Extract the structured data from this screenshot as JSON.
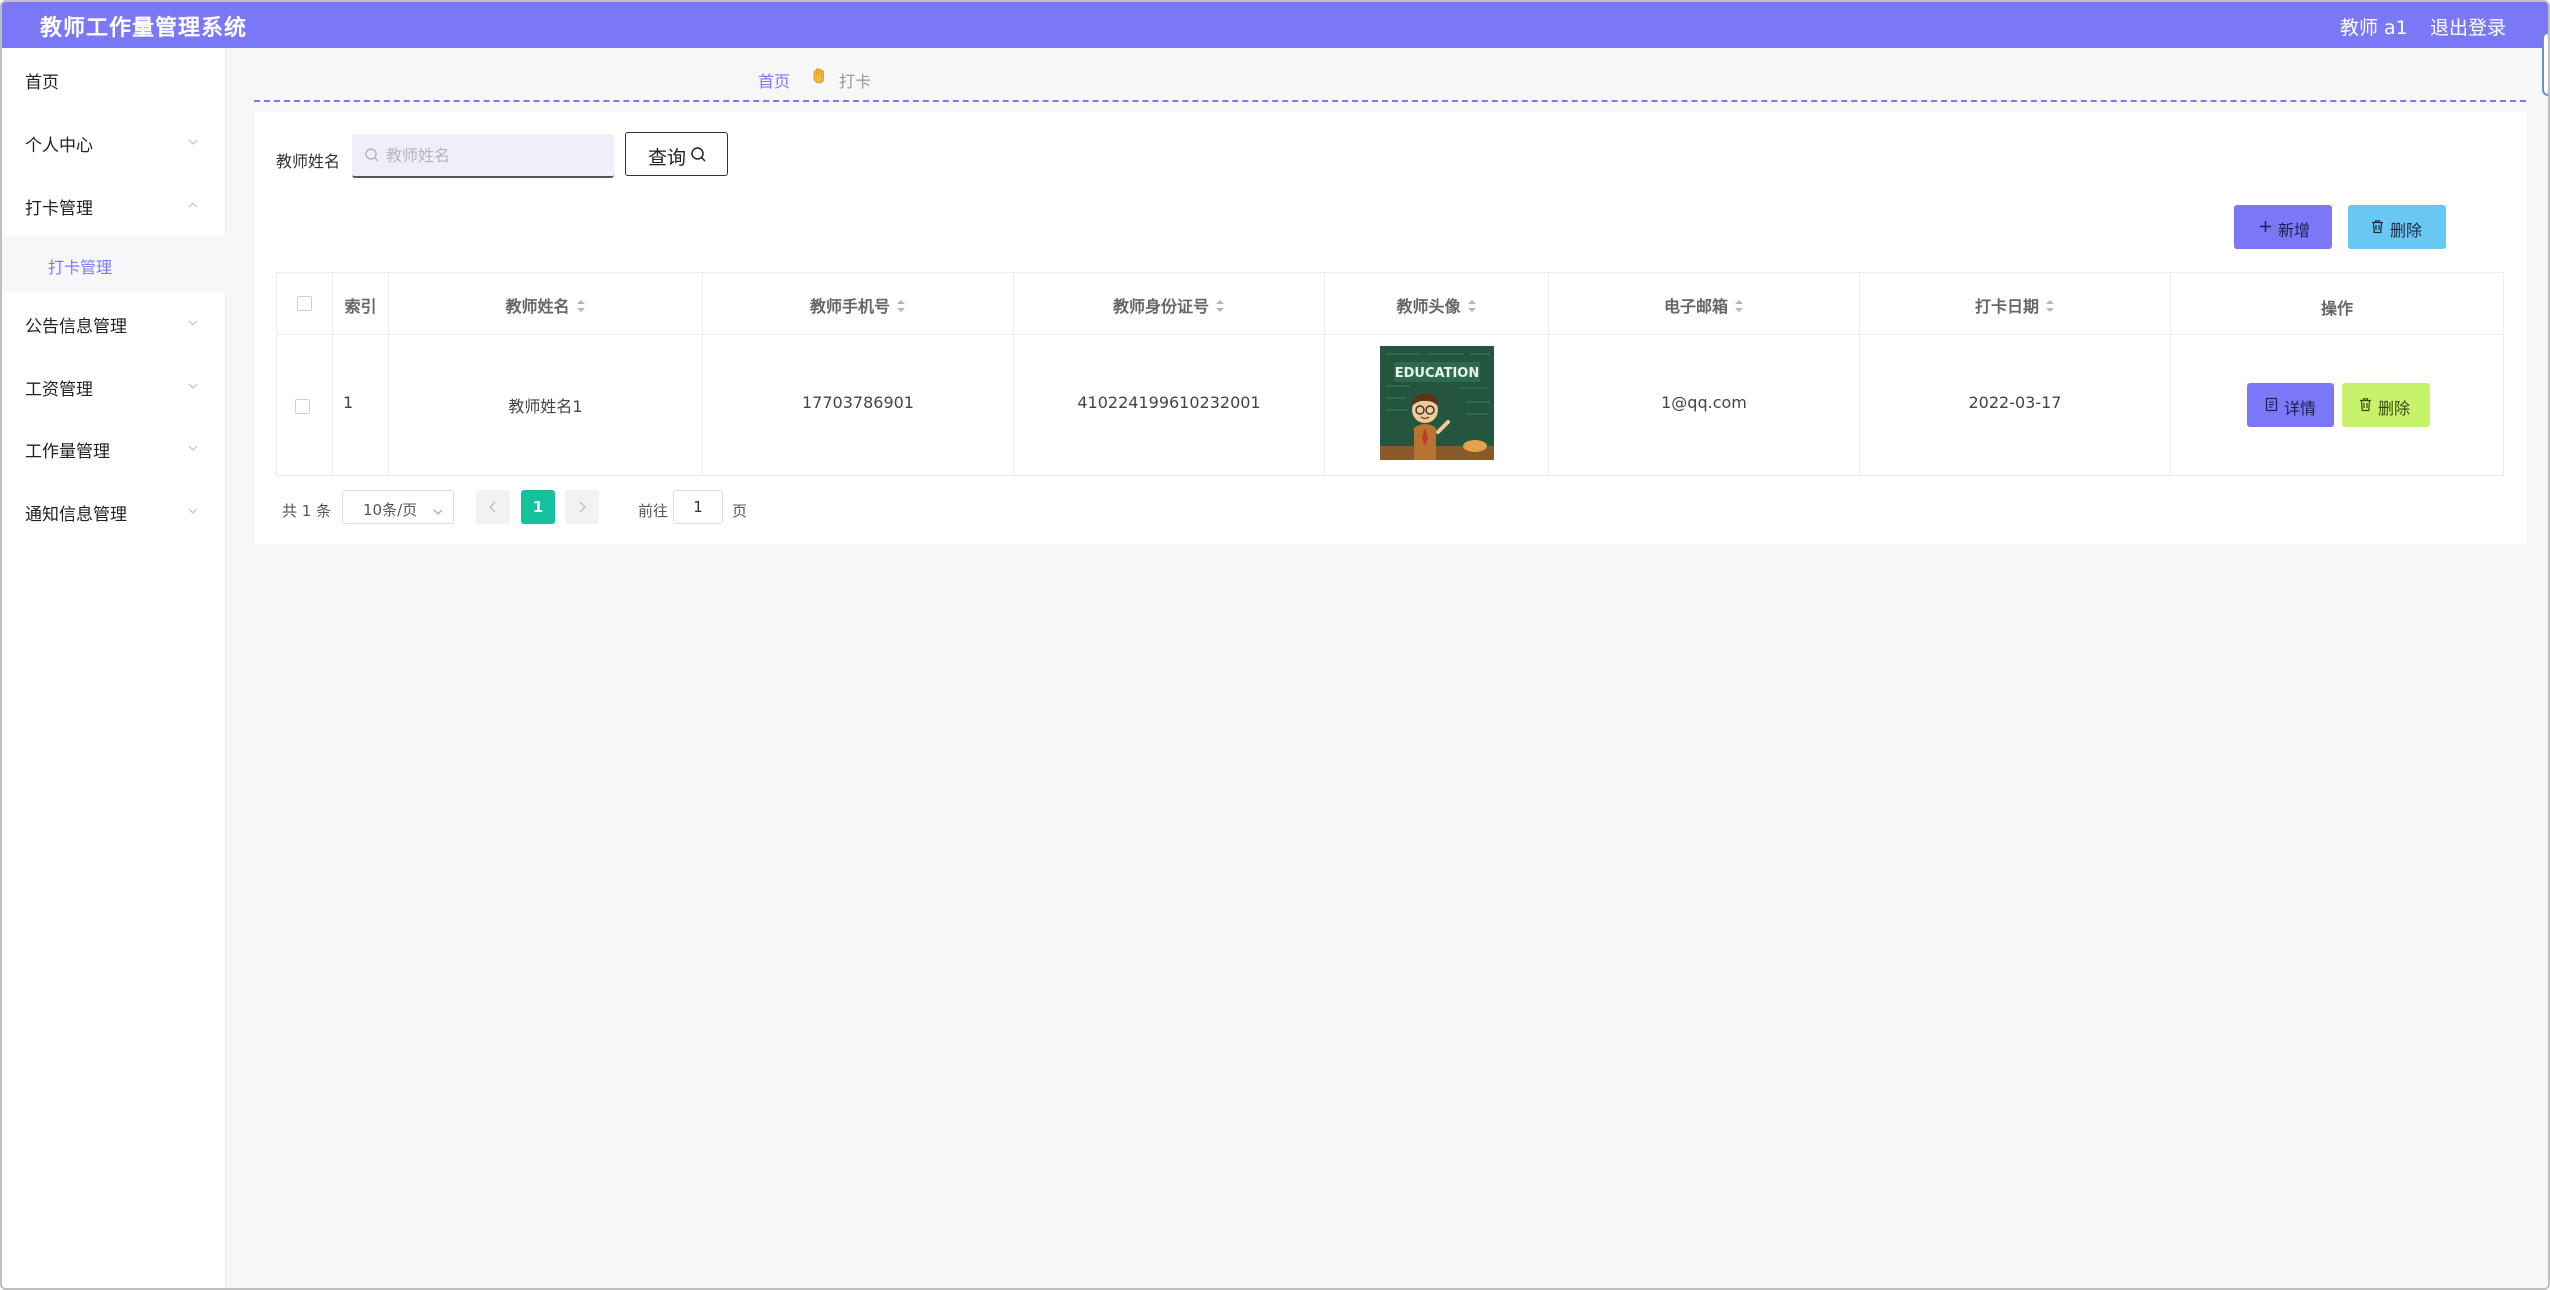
{
  "header": {
    "title": "教师工作量管理系统",
    "user": "教师 a1",
    "logout": "退出登录"
  },
  "sidebar": {
    "items": [
      {
        "label": "首页"
      },
      {
        "label": "个人中心"
      },
      {
        "label": "打卡管理"
      },
      {
        "label": "公告信息管理"
      },
      {
        "label": "工资管理"
      },
      {
        "label": "工作量管理"
      },
      {
        "label": "通知信息管理"
      }
    ],
    "sub_item": "打卡管理"
  },
  "breadcrumb": {
    "home": "首页",
    "current": "打卡"
  },
  "search": {
    "label": "教师姓名",
    "placeholder": "教师姓名",
    "value": "",
    "query_label": "查询"
  },
  "toolbar": {
    "add_label": "新增",
    "delete_label": "删除"
  },
  "table": {
    "columns": [
      "索引",
      "教师姓名",
      "教师手机号",
      "教师身份证号",
      "教师头像",
      "电子邮箱",
      "打卡日期",
      "操作"
    ],
    "rows": [
      {
        "index": "1",
        "name": "教师姓名1",
        "phone": "17703786901",
        "id_number": "410224199610232001",
        "avatar_text": "EDUCATION",
        "email": "1@qq.com",
        "date": "2022-03-17",
        "detail_label": "详情",
        "delete_label": "删除"
      }
    ]
  },
  "pagination": {
    "total": "共 1 条",
    "page_size": "10条/页",
    "current_page": "1",
    "goto_prefix": "前往",
    "goto_value": "1",
    "goto_suffix": "页"
  },
  "colors": {
    "accent": "#7b78f8",
    "info": "#68c7f3",
    "success": "#13c29b",
    "lime": "#c7f26b"
  }
}
